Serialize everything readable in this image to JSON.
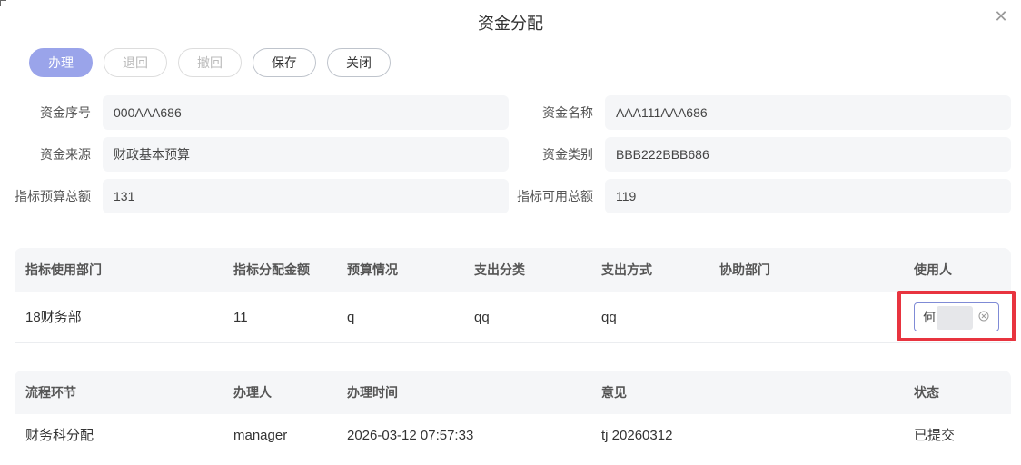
{
  "dialog": {
    "title": "资金分配",
    "close_icon": "close-icon"
  },
  "toolbar": {
    "handle": "办理",
    "return": "退回",
    "withdraw": "撤回",
    "save": "保存",
    "close": "关闭"
  },
  "form": {
    "fund_serial": {
      "label": "资金序号",
      "value": "000AAA686"
    },
    "fund_name": {
      "label": "资金名称",
      "value": "AAA111AAA686"
    },
    "fund_source": {
      "label": "资金来源",
      "value": "财政基本预算"
    },
    "fund_category": {
      "label": "资金类别",
      "value": "BBB222BBB686"
    },
    "budget_total": {
      "label": "指标预算总额",
      "value": "131"
    },
    "available_total": {
      "label": "指标可用总额",
      "value": "119"
    }
  },
  "allocation_table": {
    "headers": [
      "指标使用部门",
      "指标分配金额",
      "预算情况",
      "支出分类",
      "支出方式",
      "协助部门",
      "使用人"
    ],
    "rows": [
      {
        "dept": "18财务部",
        "amount": "11",
        "budget": "q",
        "category": "qq",
        "method": "qq",
        "assist": "",
        "user": "何"
      }
    ]
  },
  "flow_table": {
    "headers": [
      "流程环节",
      "办理人",
      "办理时间",
      "意见",
      "状态"
    ],
    "rows": [
      {
        "step": "财务科分配",
        "handler": "manager",
        "time": "2026-03-12 07:57:33",
        "opinion": "tj 20260312",
        "status": "已提交"
      }
    ]
  },
  "colors": {
    "primary_disabled": "#9aa4ea",
    "highlight": "#e8343f",
    "field_bg": "#f5f6f8"
  }
}
